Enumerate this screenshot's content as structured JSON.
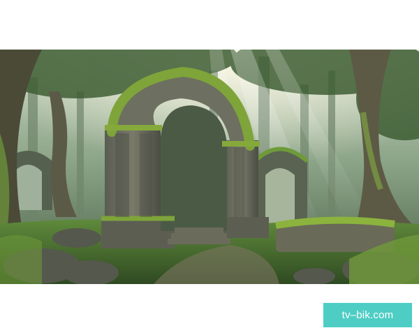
{
  "image": {
    "subject": "forest-ruins-arch-illustration",
    "icons": [
      "ruined-stone-arch",
      "mossy-tree-trunk",
      "light-rays",
      "grass-ground",
      "rocks"
    ]
  },
  "watermark": {
    "text": "tv–bik.com",
    "background_color": "#4ecdc4",
    "text_color": "#ffffff"
  }
}
